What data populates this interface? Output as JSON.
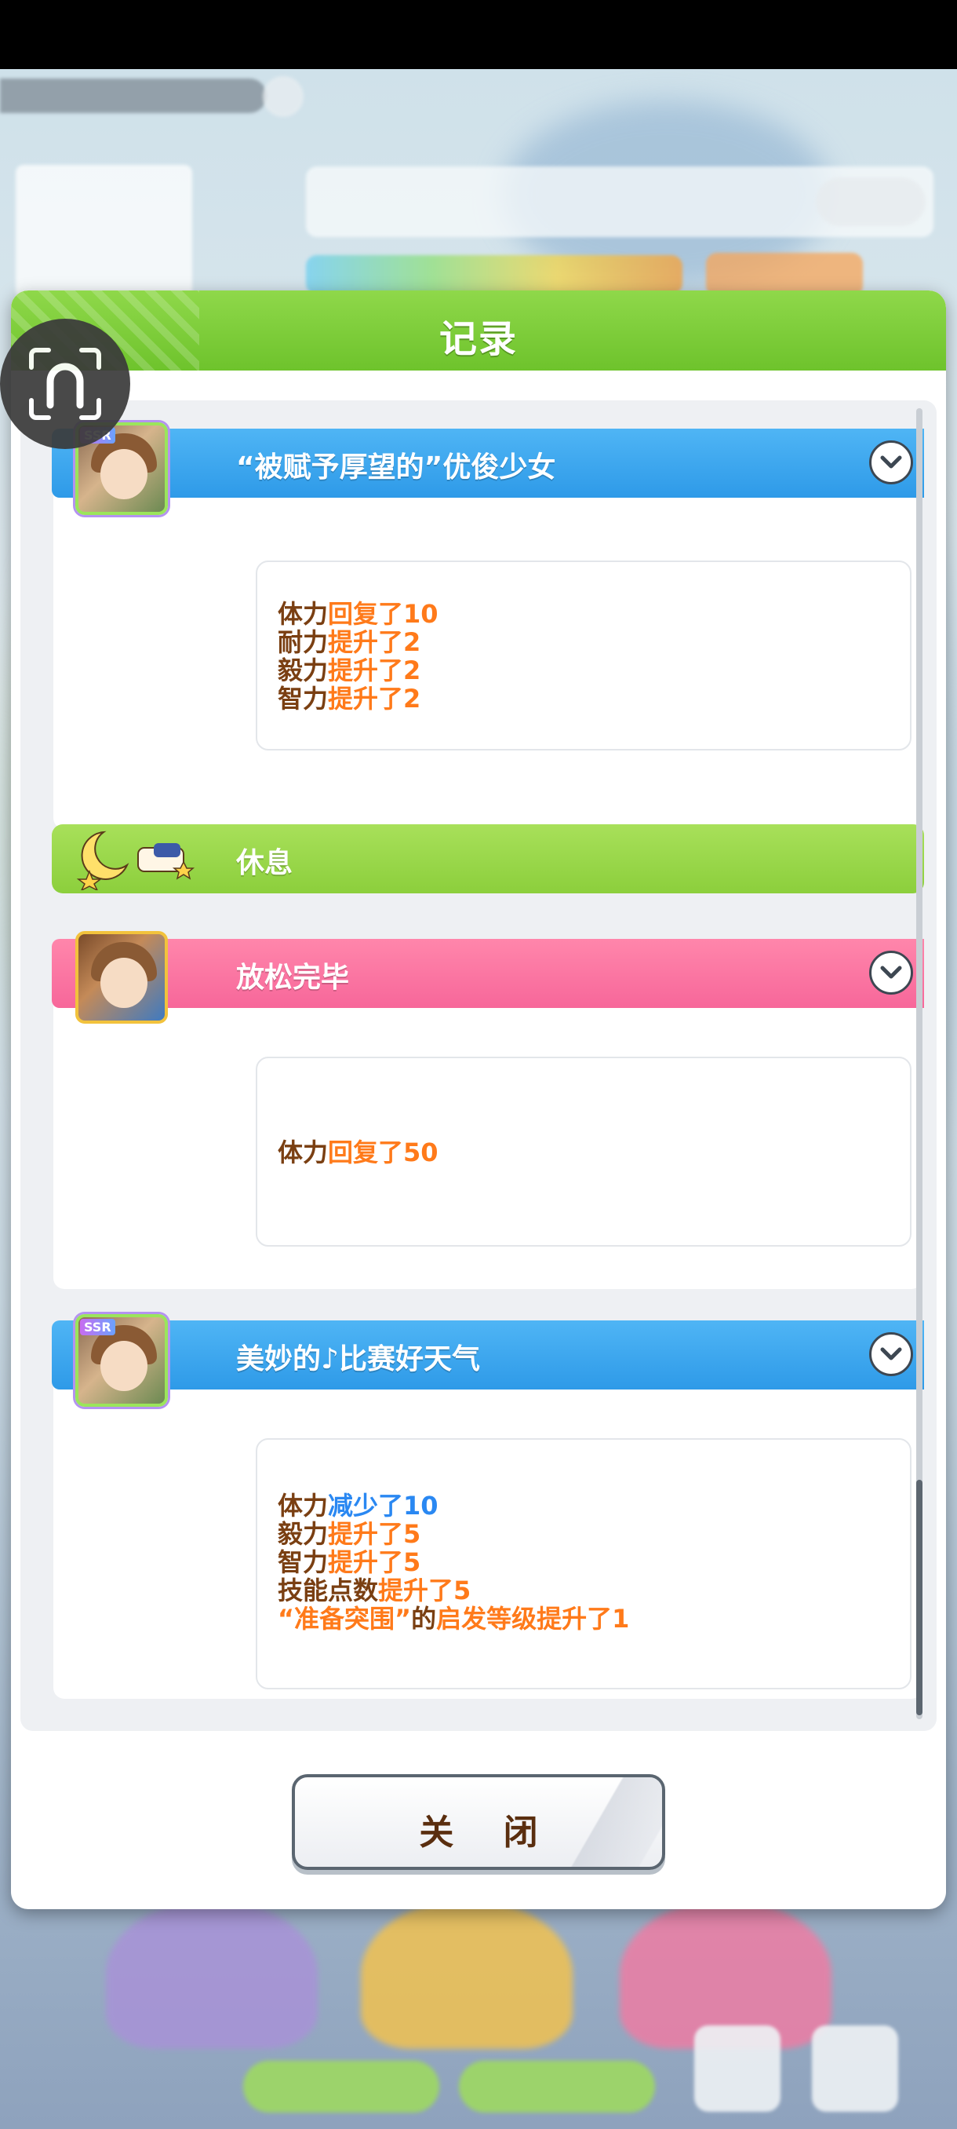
{
  "dialog": {
    "title": "记录",
    "close_label": "关 闭"
  },
  "events": [
    {
      "title": "“被赋予厚望的”优俊少女",
      "rarity": "SSR",
      "lines": [
        [
          {
            "t": "体力",
            "c": "k"
          },
          {
            "t": "回复了10",
            "c": "up"
          }
        ],
        [
          {
            "t": "耐力",
            "c": "k"
          },
          {
            "t": "提升了2",
            "c": "up"
          }
        ],
        [
          {
            "t": "毅力",
            "c": "k"
          },
          {
            "t": "提升了2",
            "c": "up"
          }
        ],
        [
          {
            "t": "智力",
            "c": "k"
          },
          {
            "t": "提升了2",
            "c": "up"
          }
        ]
      ]
    },
    {
      "title": "休息"
    },
    {
      "title": "放松完毕",
      "lines": [
        [
          {
            "t": "体力",
            "c": "k"
          },
          {
            "t": "回复了50",
            "c": "up"
          }
        ]
      ]
    },
    {
      "title": "美妙的♪比赛好天气",
      "rarity": "SSR",
      "lines": [
        [
          {
            "t": "体力",
            "c": "k"
          },
          {
            "t": "减少了10",
            "c": "down"
          }
        ],
        [
          {
            "t": "毅力",
            "c": "k"
          },
          {
            "t": "提升了5",
            "c": "up"
          }
        ],
        [
          {
            "t": "智力",
            "c": "k"
          },
          {
            "t": "提升了5",
            "c": "up"
          }
        ],
        [
          {
            "t": "技能点数",
            "c": "k"
          },
          {
            "t": "提升了5",
            "c": "up"
          }
        ],
        [
          {
            "t": "“准备突围”",
            "c": "up"
          },
          {
            "t": "的",
            "c": "k"
          },
          {
            "t": "启发等级提升了1",
            "c": "up"
          }
        ]
      ]
    }
  ],
  "colors": {
    "header_green": "#6ec32c",
    "banner_blue": "#2e9ae8",
    "banner_pink": "#f7679a",
    "banner_green": "#8ccf3c",
    "stat_label": "#7a3f12",
    "increase": "#ff7a1a",
    "decrease": "#2a88f2"
  },
  "icons": [
    "chevron-down-icon",
    "crescent-moon-icon",
    "horseshoe-icon"
  ]
}
